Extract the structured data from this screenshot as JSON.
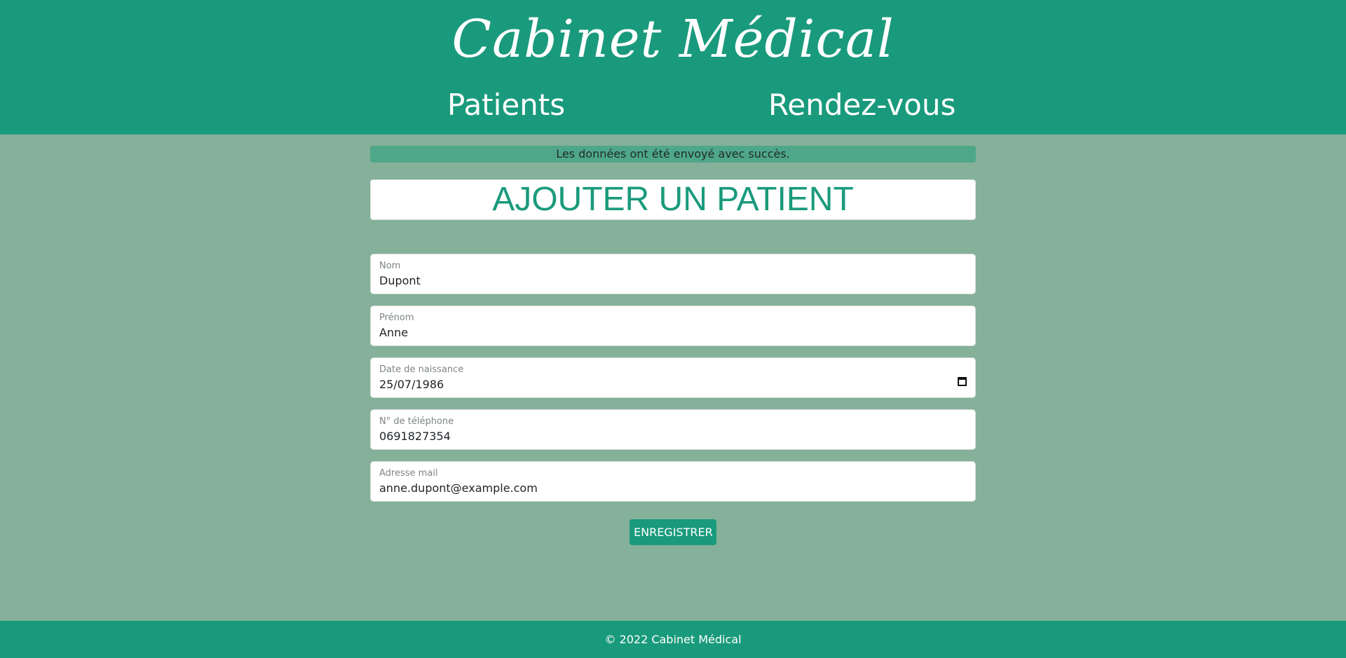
{
  "header": {
    "brand": "Cabinet Médical",
    "nav": [
      {
        "label": "Patients"
      },
      {
        "label": "Rendez-vous"
      }
    ]
  },
  "alert": {
    "message": "Les données ont été envoyé avec succès."
  },
  "form": {
    "title": "AJOUTER UN PATIENT",
    "fields": [
      {
        "label": "Nom",
        "value": "Dupont"
      },
      {
        "label": "Prénom",
        "value": "Anne"
      },
      {
        "label": "Date de naissance",
        "value": "25/07/1986",
        "icon": "calendar-icon"
      },
      {
        "label": "N° de téléphone",
        "value": "0691827354"
      },
      {
        "label": "Adresse mail",
        "value": "anne.dupont@example.com"
      }
    ],
    "submit_label": "ENREGISTRER"
  },
  "footer": {
    "text": "© 2022 Cabinet Médical"
  },
  "colors": {
    "primary": "#1a9a7c",
    "background": "#85b09a",
    "alert": "#4fa78a"
  }
}
